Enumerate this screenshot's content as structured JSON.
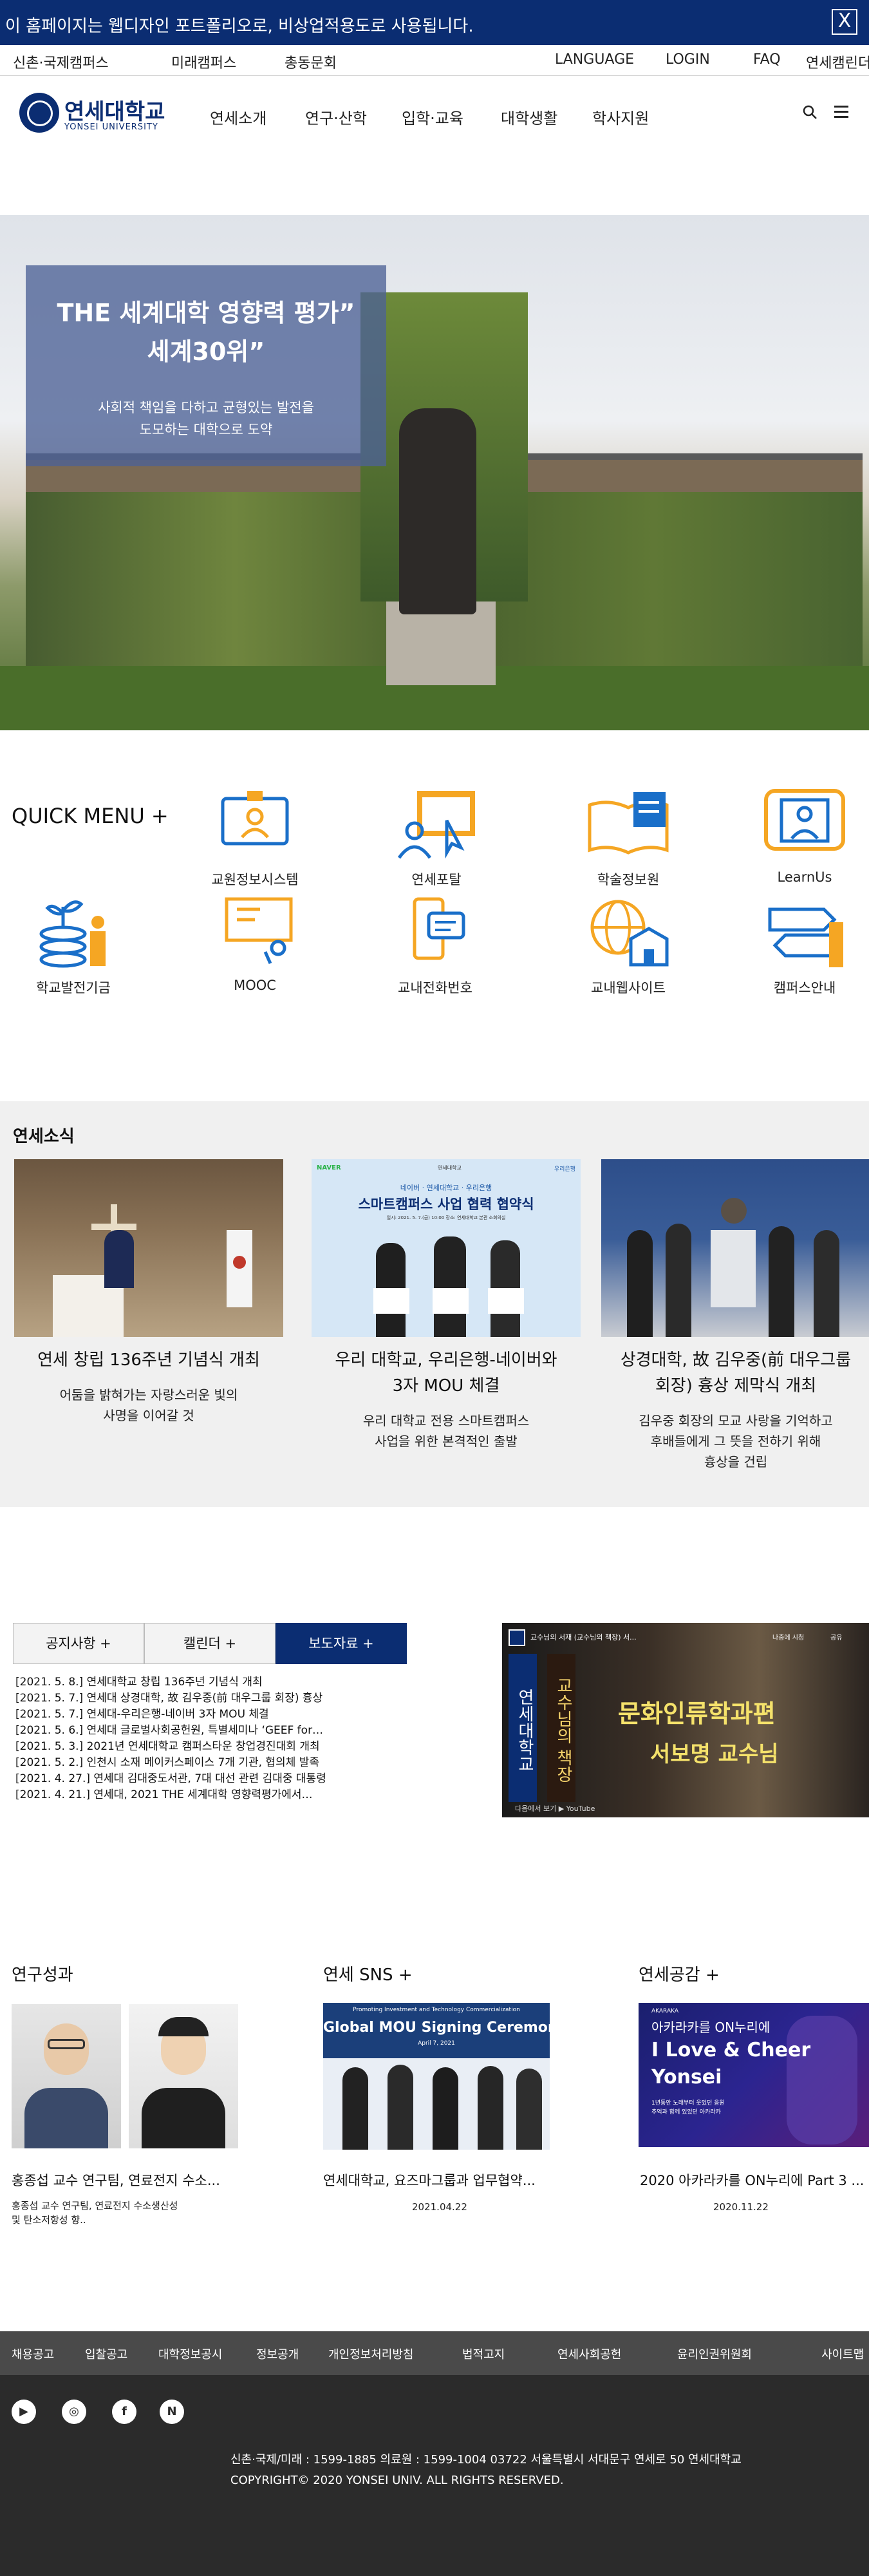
{
  "notice": {
    "text": "이 홈페이지는 웹디자인 포트폴리오로, 비상업적용도로 사용됩니다.",
    "close": "X"
  },
  "util": {
    "left": [
      "신촌·국제캠퍼스",
      "미래캠퍼스",
      "총동문회"
    ],
    "right": [
      "LANGUAGE",
      "LOGIN",
      "FAQ",
      "연세캠린더"
    ]
  },
  "logo": {
    "kr": "연세대학교",
    "en": "YONSEI UNIVERSITY"
  },
  "gnb": [
    "연세소개",
    "연구·산학",
    "입학·교육",
    "대학생활",
    "학사지원"
  ],
  "hero": {
    "title_line1": "THE 세계대학 영향력 평가”",
    "title_line2": "세계30위”",
    "sub_line1": "사회적 책임을 다하고 균형있는 발전을",
    "sub_line2": "도모하는 대학으로 도약"
  },
  "quick": {
    "title": "QUICK MENU +",
    "items": [
      "교원정보시스템",
      "연세포탈",
      "학술정보원",
      "LearnUs",
      "학교발전기금",
      "MOOC",
      "교내전화번호",
      "교내웹사이트",
      "캠퍼스안내"
    ]
  },
  "news": {
    "title": "연세소식",
    "cards": [
      {
        "title": "연세 창립 136주년 기념식 개최",
        "title2": "",
        "desc1": "어둠을 밝혀가는 자랑스러운 빛의",
        "desc2": "사명을 이어갈 것",
        "desc3": ""
      },
      {
        "title": "우리 대학교, 우리은행-네이버와",
        "title2": "3자 MOU 체결",
        "desc1": "우리 대학교 전용 스마트캠퍼스",
        "desc2": "사업을 위한 본격적인 출발",
        "desc3": ""
      },
      {
        "title": "상경대학, 故 김우중(前 대우그룹",
        "title2": "회장) 흉상 제막식 개최",
        "desc1": "김우중 회장의 모교 사랑을 기억하고",
        "desc2": "후배들에게 그 뜻을 전하기 위해",
        "desc3": "흉상을 건립"
      }
    ],
    "card2_overlay": {
      "brand_left": "NAVER",
      "brand_right": "우리은행",
      "top": "연세대학교",
      "line1": "네이버 · 연세대학교 · 우리은행",
      "line2": "스마트캠퍼스 사업 협력 협약식",
      "meta": "일시: 2021. 5. 7.(금) 10:00   장소: 연세대학교 본관 소회의실"
    }
  },
  "tabs": {
    "items": [
      "공지사항  +",
      "캘린더  +",
      "보도자료  +"
    ],
    "active": 2
  },
  "notices": [
    "[2021. 5. 8.] 연세대학교 창립 136주년 기념식 개최",
    "[2021. 5. 7.] 연세대 상경대학, 故 김우중(前 대우그룹 회장) 흉상",
    "[2021. 5. 7.] 연세대-우리은행-네이버 3자 MOU 체결",
    "[2021. 5. 6.] 연세대 글로벌사회공헌원, 특별세미나 ‘GEEF for…",
    "[2021. 5. 3.] 2021년 연세대학교 캠퍼스타운 창업경진대회 개최",
    "[2021. 5. 2.] 인천시 소재 메이커스페이스 7개 기관, 협의체 발족",
    "[2021. 4. 27.] 연세대 김대중도서관, 7대 대선 관련 김대중 대통령",
    "[2021. 4. 21.] 연세대, 2021 THE 세계대학 영향력평가에서…"
  ],
  "video": {
    "channel": "연세대학교",
    "title": "교수님의 서재 (교수님의 책장) 서...",
    "big1": "교수님의 책장",
    "big2": "문화인류학과편",
    "big3": "서보명 교수님",
    "watch": "나중에 시청",
    "share": "공유",
    "footer": "다음에서 보기 ▶ YouTube"
  },
  "research": {
    "title": "연구성과",
    "caption": "홍종섭 교수 연구팀, 연료전지 수소...",
    "sub1": "홍종섭 교수 연구팀, 연료전지 수소생산성",
    "sub2": " 및 탄소저항성 향.."
  },
  "sns": {
    "title": "연세 SNS +",
    "caption": "연세대학교, 요즈마그룹과 업무협약...",
    "date": "2021.04.22",
    "img_line1": "Promoting Investment and Technology Commercialization",
    "img_line2": "Global MOU Signing Ceremony",
    "img_line3": "April 7, 2021"
  },
  "empathy": {
    "title": "연세공감 +",
    "caption": "2020 아카라카를 ON누리에 Part 3 ...",
    "date": "2020.11.22",
    "img_small": "AKARAKA",
    "img_kr": "아카라카를 ON누리에",
    "img_big1": "I Love & Cheer",
    "img_big2": "Yonsei",
    "img_sub1": "1년동안 노래부터 웃었던 응원",
    "img_sub2": "추억과 함께 있었던 아카라카"
  },
  "footer": {
    "links": [
      "채용공고",
      "입찰공고",
      "대학정보공시",
      "정보공개",
      "개인정보처리방침",
      "법적고지",
      "연세사회공헌",
      "윤리인권위원회",
      "사이트맵"
    ],
    "sns": [
      "▶",
      "◎",
      "f",
      "N"
    ],
    "addr": "신촌·국제/미래 : 1599-1885 의료원 : 1599-1004 03722 서울특별시 서대문구 연세로 50 연세대학교",
    "copy": "COPYRIGHT© 2020 YONSEI UNIV. ALL RIGHTS RESERVED."
  },
  "colors": {
    "navy": "#0b2d72",
    "heroBox": "#4d6196",
    "iconBlue": "#1a6fc9",
    "iconOrange": "#f5a623"
  }
}
